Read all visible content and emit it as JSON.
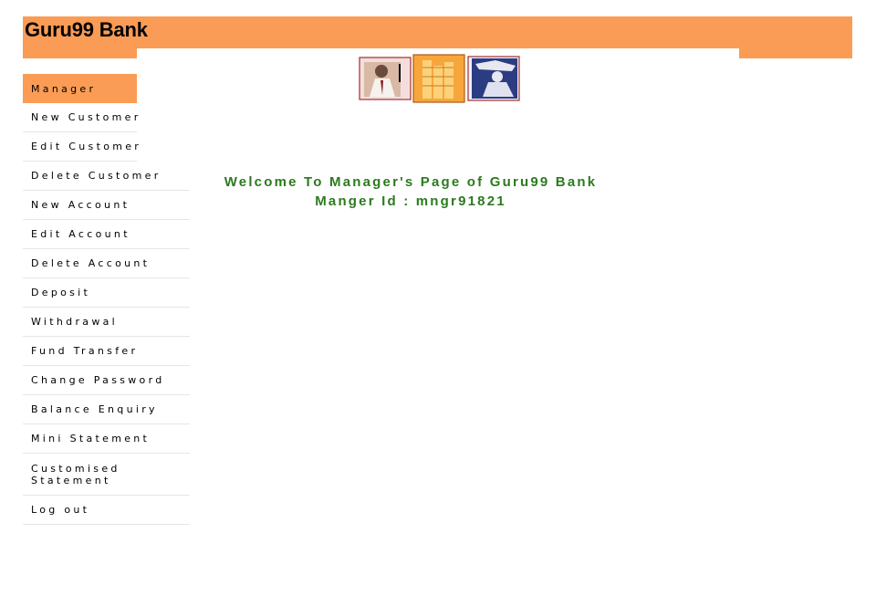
{
  "header": {
    "title": "Guru99 Bank",
    "bg_color": "#fa9c55"
  },
  "banner": {
    "icons": [
      "businessman-phone-image",
      "coins-image",
      "woman-laptop-image"
    ]
  },
  "sidebar": {
    "items": [
      {
        "label": "Manager",
        "active": true
      },
      {
        "label": "New Customer"
      },
      {
        "label": "Edit Customer"
      },
      {
        "label": "Delete Customer"
      },
      {
        "label": "New Account"
      },
      {
        "label": "Edit Account"
      },
      {
        "label": "Delete Account"
      },
      {
        "label": "Deposit"
      },
      {
        "label": "Withdrawal"
      },
      {
        "label": "Fund Transfer"
      },
      {
        "label": "Change Password"
      },
      {
        "label": "Balance Enquiry"
      },
      {
        "label": "Mini Statement"
      },
      {
        "label": "Customised Statement"
      },
      {
        "label": "Log out"
      }
    ]
  },
  "main": {
    "welcome": "Welcome To Manager's Page of Guru99 Bank",
    "manager_id": "Manger Id : mngr91821",
    "text_color": "#2c7a1e"
  }
}
